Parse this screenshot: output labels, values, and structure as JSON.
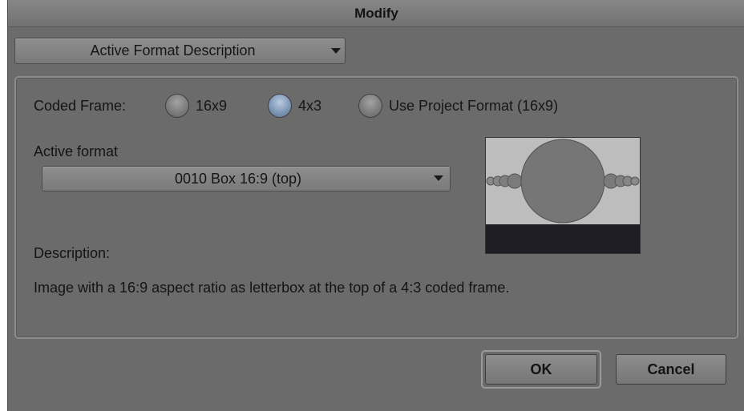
{
  "dialog": {
    "title": "Modify",
    "mode_dropdown": {
      "value": "Active Format Description"
    }
  },
  "coded_frame": {
    "label": "Coded Frame:",
    "options": [
      {
        "label": "16x9",
        "checked": false
      },
      {
        "label": "4x3",
        "checked": true
      },
      {
        "label": "Use Project Format (16x9)",
        "checked": false
      }
    ]
  },
  "active_format": {
    "label": "Active format",
    "value": "0010 Box 16:9 (top)"
  },
  "preview": {
    "icon": "letterbox-top-preview"
  },
  "description": {
    "label": "Description:",
    "text": "Image with a 16:9 aspect ratio as letterbox at the top of a 4:3 coded frame."
  },
  "buttons": {
    "ok": "OK",
    "cancel": "Cancel"
  },
  "colors": {
    "dialog_bg": "#6b6b6b",
    "radio_selected": "#7f97b7",
    "preview_bg": "#bdbdbd",
    "preview_bar": "#1e1c24"
  }
}
